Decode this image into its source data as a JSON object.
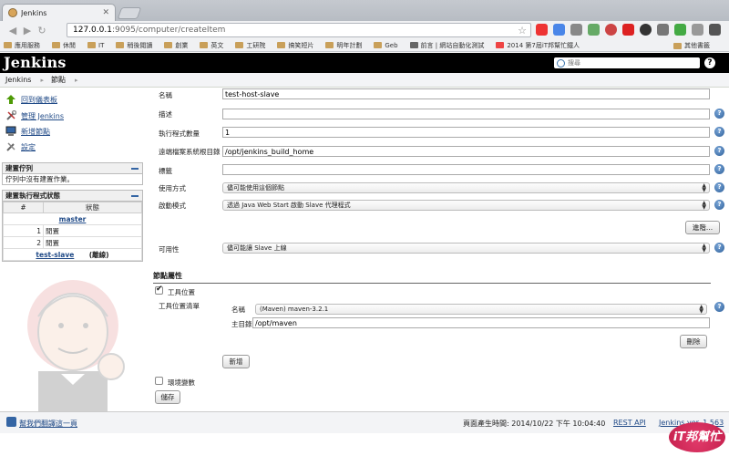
{
  "browser": {
    "tab_title": "Jenkins",
    "url_host": "127.0.0.1",
    "url_rest": ":9095/computer/createItem",
    "bookmarks": [
      "應用服務",
      "休閒",
      "IT",
      "稍後閱讀",
      "創業",
      "英文",
      "工研院",
      "搞笑短片",
      "明年計劃",
      "Geb",
      "前言 | 網站自動化測試",
      "2014 第7屆iT邦幫忙鐵人"
    ],
    "bookmarks_other": "其他書籤"
  },
  "header": {
    "logo": "Jenkins",
    "search_placeholder": "搜尋",
    "help": "?"
  },
  "breadcrumbs": [
    "Jenkins",
    "節點"
  ],
  "side": {
    "tasks": [
      "回到儀表板",
      "管理 Jenkins",
      "新增節點",
      "設定"
    ],
    "build_queue": {
      "title": "建置佇列",
      "empty_text": "佇列中沒有建置作業。"
    },
    "executors": {
      "title": "建置執行程式狀態",
      "col_num": "#",
      "col_status": "狀態",
      "master": "master",
      "rows": [
        {
          "num": "1",
          "status": "閒置"
        },
        {
          "num": "2",
          "status": "閒置"
        }
      ],
      "slave_name": "test-slave",
      "slave_status": "(離線)"
    }
  },
  "form": {
    "name_label": "名稱",
    "name_value": "test-host-slave",
    "desc_label": "描述",
    "desc_value": "",
    "executors_label": "執行程式數量",
    "executors_value": "1",
    "remote_root_label": "遠端檔案系統根目錄",
    "remote_root_value": "/opt/jenkins_build_home",
    "labels_label": "標籤",
    "labels_value": "",
    "usage_label": "使用方式",
    "usage_value": "儘可能使用這個節點",
    "launch_label": "啟動模式",
    "launch_value": "透過 Java Web Start 啟動 Slave 代理程式",
    "advanced_button": "進階...",
    "availability_label": "可用性",
    "availability_value": "儘可能讓 Slave 上線",
    "node_props_title": "節點屬性",
    "tool_locations_label": "工具位置",
    "tool_list_label": "工具位置清單",
    "tool_name_label": "名稱",
    "tool_name_value": "(Maven) maven-3.2.1",
    "tool_home_label": "主目錄",
    "tool_home_value": "/opt/maven",
    "delete_button": "刪除",
    "add_button": "新增",
    "env_vars_label": "環境變數",
    "save_button": "儲存",
    "help_glyph": "?"
  },
  "footer": {
    "translate_link": "幫我們翻譯這一頁",
    "generated": "頁面產生時間: 2014/10/22 下午 10:04:40",
    "rest_api": "REST API",
    "version": "Jenkins ver. 1.563"
  },
  "watermark": "iT邦幫忙"
}
